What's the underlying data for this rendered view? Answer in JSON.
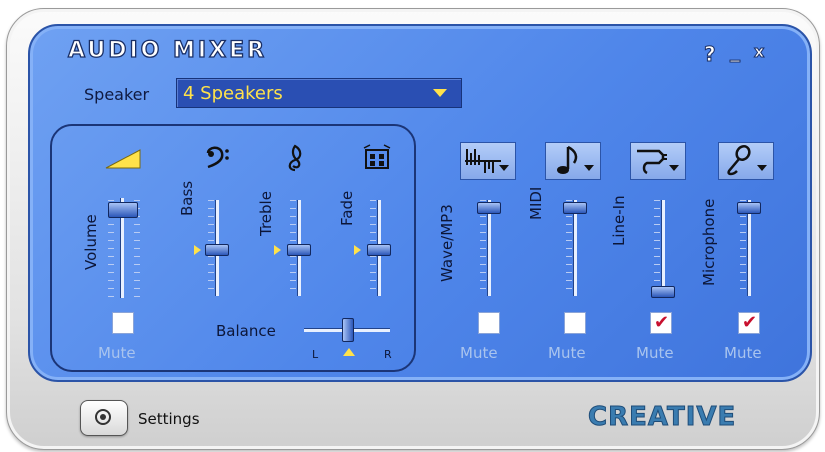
{
  "window": {
    "title": "AUDIO MIXER",
    "help_label": "?",
    "minimize_label": "_",
    "close_label": "x"
  },
  "speaker": {
    "label": "Speaker",
    "selected": "4 Speakers"
  },
  "master": {
    "volume_label": "Volume",
    "bass_label": "Bass",
    "treble_label": "Treble",
    "fade_label": "Fade",
    "mute_label": "Mute",
    "volume_muted": false,
    "balance_label": "Balance",
    "balance_left": "L",
    "balance_right": "R"
  },
  "channels": [
    {
      "label": "Wave/MP3",
      "icon": "waveform-icon",
      "mute_label": "Mute",
      "muted": false
    },
    {
      "label": "MIDI",
      "icon": "music-note-icon",
      "mute_label": "Mute",
      "muted": false
    },
    {
      "label": "Line-In",
      "icon": "plug-icon",
      "mute_label": "Mute",
      "muted": true
    },
    {
      "label": "Microphone",
      "icon": "microphone-icon",
      "mute_label": "Mute",
      "muted": true
    }
  ],
  "footer": {
    "settings_label": "Settings",
    "brand": "CREATIVE"
  },
  "colors": {
    "panel_blue": "#4f86ea",
    "accent_yellow": "#ffe24a",
    "check_red": "#c8102e"
  }
}
